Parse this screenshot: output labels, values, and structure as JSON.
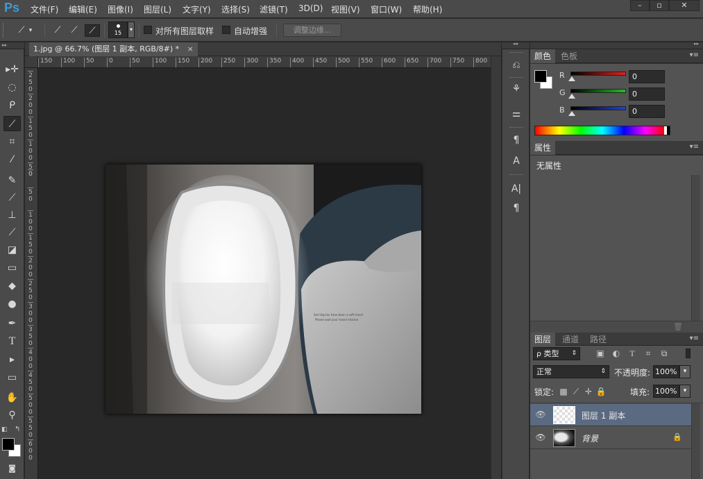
{
  "app": {
    "logo": "Ps"
  },
  "menu": [
    "文件(F)",
    "编辑(E)",
    "图像(I)",
    "图层(L)",
    "文字(Y)",
    "选择(S)",
    "滤镜(T)",
    "3D(D)",
    "视图(V)",
    "窗口(W)",
    "帮助(H)"
  ],
  "window_controls": {
    "minimize": "–",
    "restore": "▫",
    "close": "✕"
  },
  "options": {
    "brush_size": "15",
    "sample_all_layers": "对所有图层取样",
    "auto_enhance": "自动增强",
    "refine_edge": "调整边缘..."
  },
  "document": {
    "tab_title": "1.jpg @ 66.7% (图层 1 副本, RGB/8#) *",
    "tab_close": "×"
  },
  "ruler_top": [
    "150",
    "100",
    "50",
    "0",
    "50",
    "100",
    "150",
    "200",
    "250",
    "300",
    "350",
    "400",
    "450",
    "500",
    "550",
    "600",
    "650",
    "700",
    "750",
    "800"
  ],
  "ruler_left": [
    "2 5 0",
    "2 0 0",
    "1 5 0",
    "1 0 0",
    "5 0",
    "0",
    "5 0",
    "1 0 0",
    "1 5 0",
    "2 0 0",
    "2 5 0",
    "3 0 0",
    "3 5 0",
    "4 0 0",
    "4 5 0",
    "5 0 0",
    "5 5 0",
    "6 0 0"
  ],
  "image_text": {
    "card_line1": "Sort big tax have been a soft travel",
    "card_line2": "Please wait your travel mission"
  },
  "color_panel": {
    "tabs": [
      "颜色",
      "色板"
    ],
    "channels": [
      {
        "label": "R",
        "value": "0",
        "color": "#e02020"
      },
      {
        "label": "G",
        "value": "0",
        "color": "#20c020"
      },
      {
        "label": "B",
        "value": "0",
        "color": "#2040e0"
      }
    ]
  },
  "properties_panel": {
    "tab": "属性",
    "content": "无属性"
  },
  "layers_panel": {
    "tabs": [
      "图层",
      "通道",
      "路径"
    ],
    "filter_kind": "ρ 类型",
    "blend_mode": "正常",
    "opacity_label": "不透明度:",
    "opacity_value": "100%",
    "lock_label": "锁定:",
    "fill_label": "填充:",
    "fill_value": "100%",
    "layers": [
      {
        "name": "图层 1 副本",
        "selected": true
      },
      {
        "name": "背景",
        "selected": false
      }
    ]
  },
  "menu_glyph": "▾≡"
}
